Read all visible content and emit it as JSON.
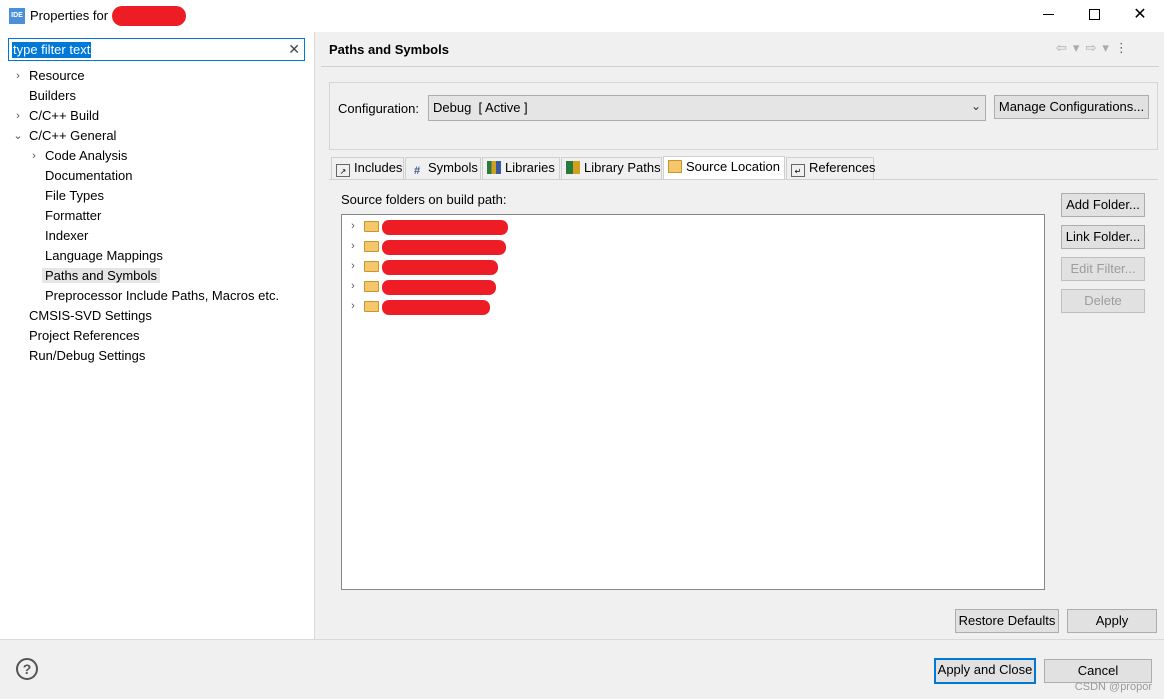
{
  "window": {
    "app_icon_text": "IDE",
    "title": "Properties for"
  },
  "filter": {
    "value": "type filter text"
  },
  "tree": {
    "items": [
      {
        "label": "Resource",
        "expander": ">"
      },
      {
        "label": "Builders",
        "expander": ""
      },
      {
        "label": "C/C++ Build",
        "expander": ">"
      },
      {
        "label": "C/C++ General",
        "expander": "v"
      },
      {
        "label": "Code Analysis",
        "expander": ">"
      },
      {
        "label": "Documentation",
        "expander": ""
      },
      {
        "label": "File Types",
        "expander": ""
      },
      {
        "label": "Formatter",
        "expander": ""
      },
      {
        "label": "Indexer",
        "expander": ""
      },
      {
        "label": "Language Mappings",
        "expander": ""
      },
      {
        "label": "Paths and Symbols",
        "expander": "",
        "selected": true
      },
      {
        "label": "Preprocessor Include Paths, Macros etc.",
        "expander": ""
      },
      {
        "label": "CMSIS-SVD Settings",
        "expander": ""
      },
      {
        "label": "Project References",
        "expander": ""
      },
      {
        "label": "Run/Debug Settings",
        "expander": ""
      }
    ]
  },
  "page": {
    "title": "Paths and Symbols"
  },
  "config": {
    "label": "Configuration:",
    "value": "Debug  [ Active ]",
    "manage_label": "Manage Configurations..."
  },
  "tabs": [
    {
      "label": "Includes",
      "icon": "includes-icon"
    },
    {
      "label": "Symbols",
      "icon": "hash-icon"
    },
    {
      "label": "Libraries",
      "icon": "libraries-icon"
    },
    {
      "label": "Library Paths",
      "icon": "library-paths-icon"
    },
    {
      "label": "Source Location",
      "icon": "folder-icon",
      "active": true
    },
    {
      "label": "References",
      "icon": "references-icon"
    }
  ],
  "source": {
    "label": "Source folders on build path:",
    "folder_count": 5
  },
  "buttons": {
    "add_folder": "Add Folder...",
    "link_folder": "Link Folder...",
    "edit_filter": "Edit Filter...",
    "delete": "Delete",
    "restore_defaults": "Restore Defaults",
    "apply": "Apply",
    "apply_and_close": "Apply and Close",
    "cancel": "Cancel"
  },
  "watermark": "CSDN @propor",
  "colors": {
    "accent": "#0078d7",
    "redaction": "#ee1c25",
    "folder": "#f5c66a"
  }
}
